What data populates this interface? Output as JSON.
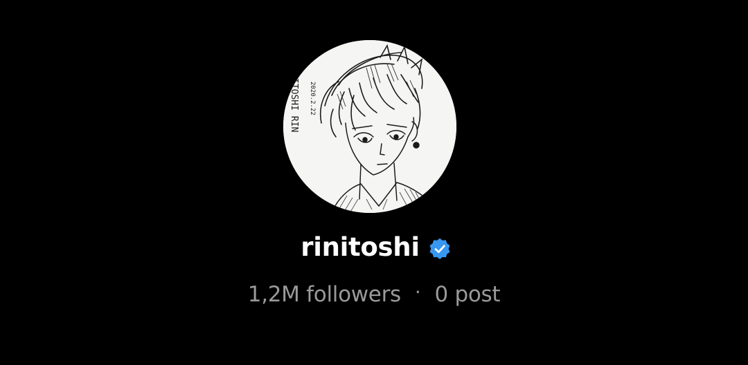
{
  "profile": {
    "username": "rinitoshi",
    "verified": true,
    "followers": "1,2M followers",
    "separator": "·",
    "posts": "0 post",
    "avatar_text": "ITOSHI RIN",
    "avatar_date": "2020.2.22"
  },
  "colors": {
    "background": "#000000",
    "username": "#ffffff",
    "stats": "#9a9a9a",
    "verified_badge": "#3897f0"
  },
  "icons": {
    "verified": "verified-badge-icon"
  }
}
